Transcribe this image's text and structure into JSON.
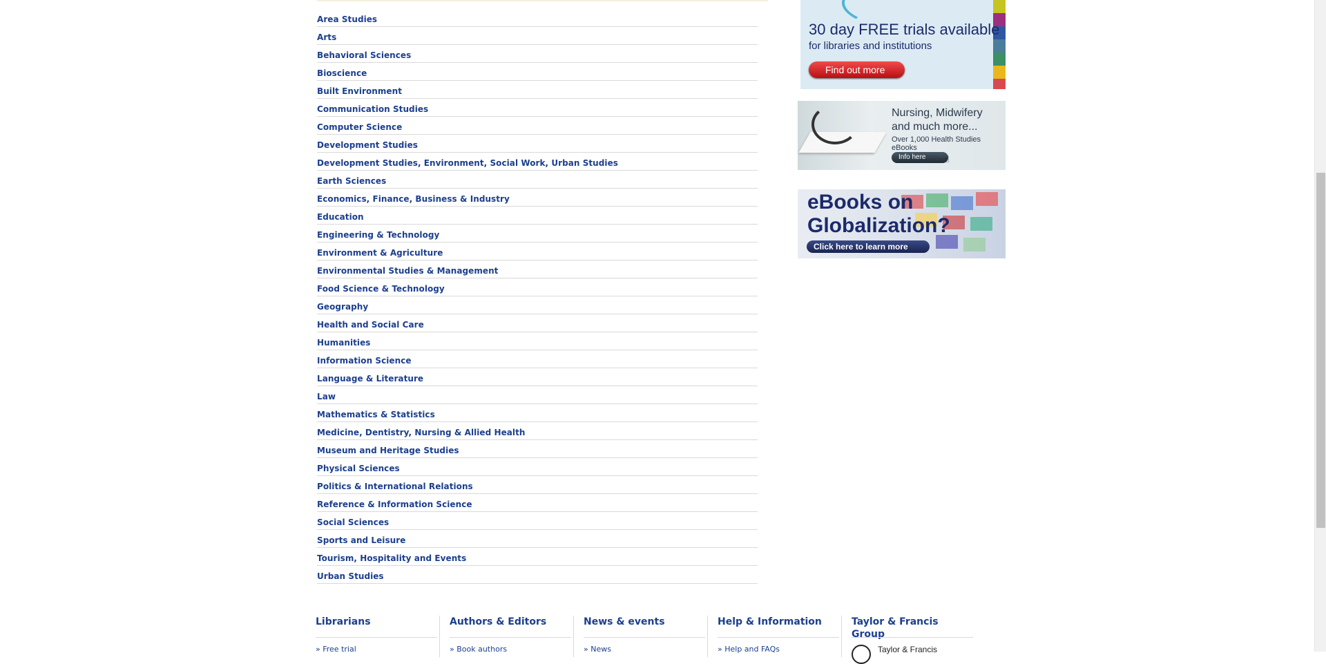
{
  "subjects": [
    "Area Studies",
    "Arts",
    "Behavioral Sciences",
    "Bioscience",
    "Built Environment",
    "Communication Studies",
    "Computer Science",
    "Development Studies",
    "Development Studies, Environment, Social Work, Urban Studies",
    "Earth Sciences",
    "Economics, Finance, Business & Industry",
    "Education",
    "Engineering & Technology",
    "Environment & Agriculture",
    "Environmental Studies & Management",
    "Food Science & Technology",
    "Geography",
    "Health and Social Care",
    "Humanities",
    "Information Science",
    "Language & Literature",
    "Law",
    "Mathematics & Statistics",
    "Medicine, Dentistry, Nursing & Allied Health",
    "Museum and Heritage Studies",
    "Physical Sciences",
    "Politics & International Relations",
    "Reference & Information Science",
    "Social Sciences",
    "Sports and Leisure",
    "Tourism, Hospitality and Events",
    "Urban Studies"
  ],
  "ads": {
    "trial": {
      "headline": "30 day FREE trials available",
      "sub": "for libraries and institutions",
      "button": "Find out more",
      "bar_colors": [
        "#c6c51f",
        "#9d2f7f",
        "#2f56a3",
        "#4a7d9a",
        "#3d8f66",
        "#e9b81d",
        "#d84a4f"
      ]
    },
    "nursing": {
      "line1": "Nursing, Midwifery",
      "line2": "and much more...",
      "line3": "Over 1,000 Health Studies eBooks",
      "button": "Info here"
    },
    "globalization": {
      "line1": "eBooks on",
      "line2": "Globalization?",
      "button": "Click here to learn more"
    }
  },
  "footer": {
    "columns": [
      {
        "title": "Librarians",
        "link": "» Free trial"
      },
      {
        "title": "Authors & Editors",
        "link": "» Book authors"
      },
      {
        "title": "News & events",
        "link": "» News"
      },
      {
        "title": "Help & Information",
        "link": "» Help and FAQs"
      },
      {
        "title": "Taylor & Francis Group",
        "link": "Taylor & Francis"
      }
    ]
  },
  "colors": {
    "link": "#1c3f8d",
    "rule": "#d9d9d9"
  }
}
